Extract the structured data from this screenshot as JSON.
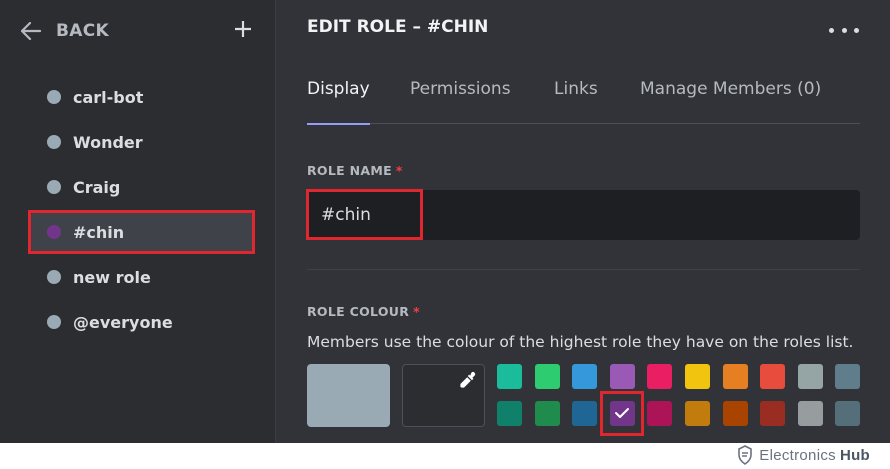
{
  "sidebar": {
    "back_label": "BACK",
    "roles": [
      {
        "name": "carl-bot",
        "color": "#99aab5",
        "selected": false
      },
      {
        "name": "Wonder",
        "color": "#99aab5",
        "selected": false
      },
      {
        "name": "Craig",
        "color": "#99aab5",
        "selected": false
      },
      {
        "name": "#chin",
        "color": "#71368a",
        "selected": true
      },
      {
        "name": "new role",
        "color": "#99aab5",
        "selected": false
      },
      {
        "name": "@everyone",
        "color": "#99aab5",
        "selected": false
      }
    ]
  },
  "main": {
    "title": "EDIT ROLE – #CHIN",
    "tabs": [
      {
        "label": "Display",
        "active": true
      },
      {
        "label": "Permissions",
        "active": false
      },
      {
        "label": "Links",
        "active": false
      },
      {
        "label": "Manage Members (0)",
        "active": false
      }
    ],
    "role_name": {
      "label": "ROLE NAME",
      "required_mark": "*",
      "value": "#chin"
    },
    "role_colour": {
      "label": "ROLE COLOUR",
      "required_mark": "*",
      "description": "Members use the colour of the highest role they have on the roles list.",
      "default_color": "#99aab5",
      "swatches_row1": [
        "#1abc9c",
        "#2ecc71",
        "#3498db",
        "#9b59b6",
        "#e91e63",
        "#f1c40f",
        "#e67e22",
        "#e74c3c",
        "#95a5a6",
        "#607d8b"
      ],
      "swatches_row2": [
        "#11806a",
        "#1f8b4c",
        "#206694",
        "#71368a",
        "#ad1457",
        "#c27c0e",
        "#a84300",
        "#992d22",
        "#979c9f",
        "#546e7a"
      ],
      "selected_swatch": "#71368a"
    }
  },
  "watermark": {
    "brand": "Electronics",
    "brand_bold": "Hub"
  }
}
